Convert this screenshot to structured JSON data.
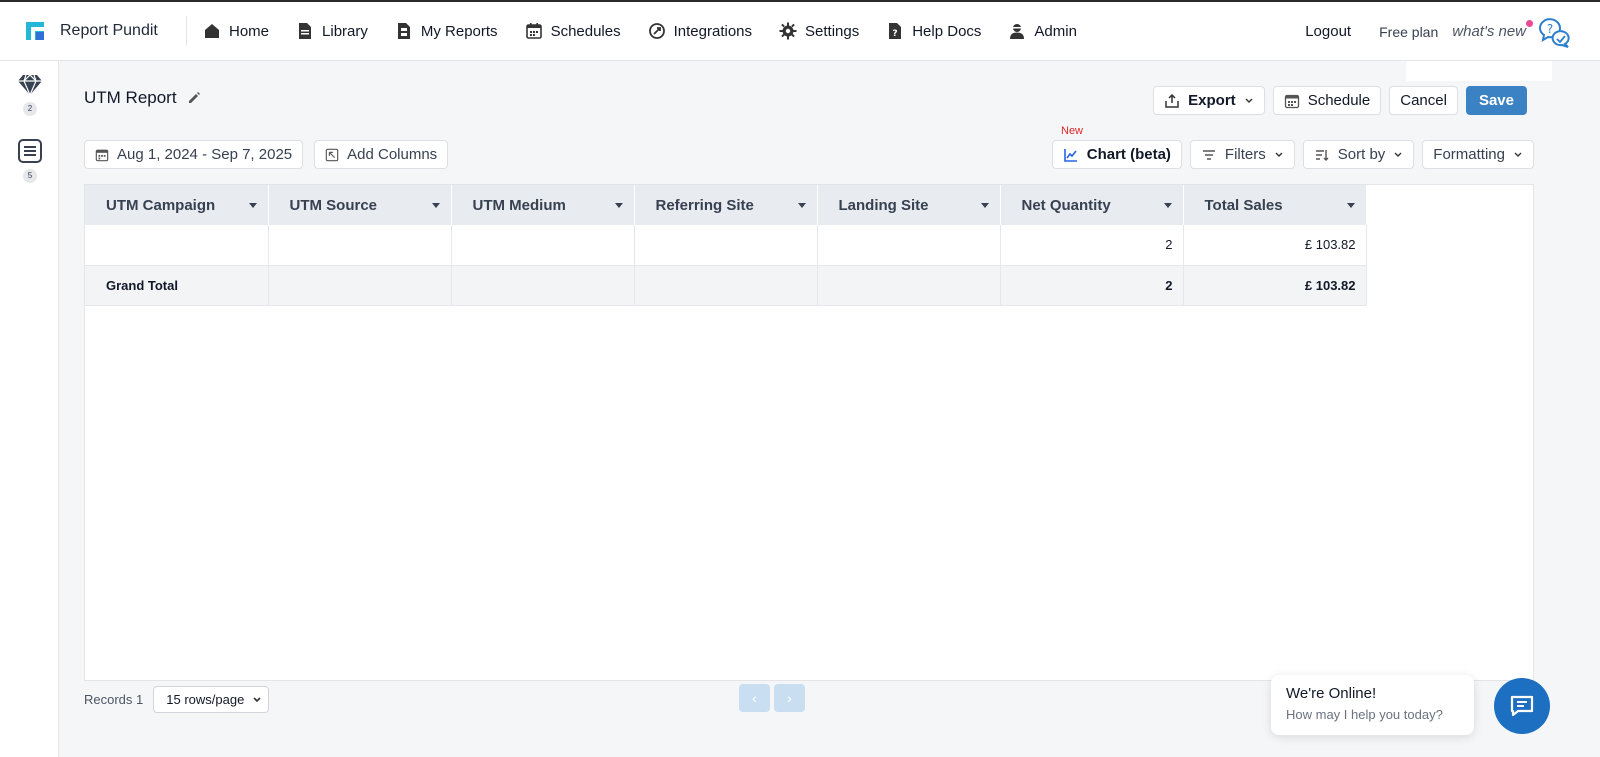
{
  "brand": {
    "name": "Report Pundit"
  },
  "nav": [
    {
      "label": "Home",
      "icon": "home-icon"
    },
    {
      "label": "Library",
      "icon": "document-icon"
    },
    {
      "label": "My Reports",
      "icon": "report-icon"
    },
    {
      "label": "Schedules",
      "icon": "calendar-icon"
    },
    {
      "label": "Integrations",
      "icon": "integrations-icon"
    },
    {
      "label": "Settings",
      "icon": "gear-icon"
    },
    {
      "label": "Help Docs",
      "icon": "help-doc-icon"
    },
    {
      "label": "Admin",
      "icon": "admin-icon"
    }
  ],
  "nav_right": {
    "logout": "Logout",
    "plan": "Free plan",
    "whats_new": "what's new"
  },
  "rail": [
    {
      "icon": "diamond-icon",
      "badge": "2"
    },
    {
      "icon": "list-icon",
      "badge": "5"
    }
  ],
  "report": {
    "title": "UTM Report"
  },
  "actions": {
    "export": "Export",
    "schedule": "Schedule",
    "cancel": "Cancel",
    "save": "Save"
  },
  "toolbar": {
    "date_range": "Aug 1, 2024 - Sep 7, 2025",
    "add_columns": "Add Columns",
    "new_tag": "New",
    "chart": "Chart (beta)",
    "filters": "Filters",
    "sort_by": "Sort by",
    "formatting": "Formatting"
  },
  "table": {
    "columns": [
      "UTM Campaign",
      "UTM Source",
      "UTM Medium",
      "Referring Site",
      "Landing Site",
      "Net Quantity",
      "Total Sales"
    ],
    "rows": [
      [
        "",
        "",
        "",
        "",
        "",
        "2",
        "£ 103.82"
      ]
    ],
    "total": [
      "Grand Total",
      "",
      "",
      "",
      "",
      "2",
      "£ 103.82"
    ]
  },
  "footer": {
    "records": "Records 1",
    "page_size": "15 rows/page"
  },
  "pager": {
    "prev": "‹",
    "next": "›"
  },
  "chat": {
    "title": "We're Online!",
    "subtitle": "How may I help you today?"
  },
  "colors": {
    "accent": "#3b82c4",
    "new_tag": "#dc2626",
    "chat_button": "#1d6fc2"
  }
}
